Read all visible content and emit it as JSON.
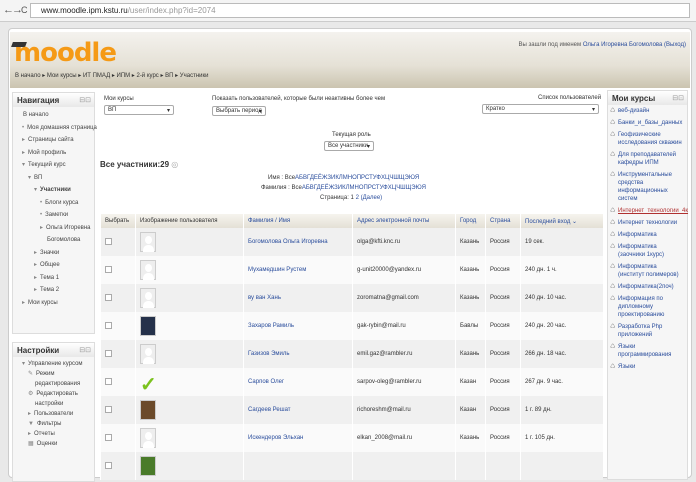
{
  "browser": {
    "url_host": "www.moodle.ipm.kstu.ru",
    "url_path": "/user/index.php?id=2074"
  },
  "header": {
    "logo": "moodle",
    "breadcrumb": "В начало ▸ Мои курсы ▸ ИТ ПМАД ▸ ИПМ ▸ 2-й курс ▸ ВП ▸ Участники",
    "login_prefix": "Вы зашли под именем",
    "login_user": "Ольга Игоревна Богомолова",
    "logout": "(Выход)"
  },
  "navigation": {
    "title": "Навигация",
    "items": [
      {
        "label": "В начало",
        "indent": 0,
        "marker": ""
      },
      {
        "label": "Моя домашняя страница",
        "indent": 1,
        "marker": "•"
      },
      {
        "label": "Страницы сайта",
        "indent": 1,
        "marker": "▸"
      },
      {
        "label": "Мой профиль",
        "indent": 1,
        "marker": "▸"
      },
      {
        "label": "Текущий курс",
        "indent": 1,
        "marker": "▾"
      },
      {
        "label": "ВП",
        "indent": 2,
        "marker": "▾"
      },
      {
        "label": "Участники",
        "indent": 3,
        "marker": "▾"
      },
      {
        "label": "Блоги курса",
        "indent": 4,
        "marker": "•"
      },
      {
        "label": "Заметки",
        "indent": 4,
        "marker": "•"
      },
      {
        "label": "Ольга Игоревна",
        "indent": 4,
        "marker": "▸"
      },
      {
        "label": "Богомолова",
        "indent": 4,
        "marker": ""
      },
      {
        "label": "Значки",
        "indent": 3,
        "marker": "▸"
      },
      {
        "label": "Общее",
        "indent": 3,
        "marker": "▸"
      },
      {
        "label": "Тема 1",
        "indent": 3,
        "marker": "▸"
      },
      {
        "label": "Тема 2",
        "indent": 3,
        "marker": "▸"
      },
      {
        "label": "Мои курсы",
        "indent": 1,
        "marker": "▸"
      }
    ]
  },
  "settings": {
    "title": "Настройки",
    "items": [
      {
        "label": "Управление курсом",
        "indent": 1,
        "marker": "▾"
      },
      {
        "label": "Режим",
        "indent": 2,
        "marker": "✎"
      },
      {
        "label": "редактирования",
        "indent": 2,
        "marker": ""
      },
      {
        "label": "Редактировать",
        "indent": 2,
        "marker": "⚙"
      },
      {
        "label": "настройки",
        "indent": 2,
        "marker": ""
      },
      {
        "label": "Пользователи",
        "indent": 2,
        "marker": "▸"
      },
      {
        "label": "Фильтры",
        "indent": 2,
        "marker": "▼"
      },
      {
        "label": "Отчеты",
        "indent": 2,
        "marker": "▸"
      },
      {
        "label": "Оценки",
        "indent": 2,
        "marker": "▦"
      }
    ]
  },
  "filters": {
    "my_courses_label": "Мои курсы",
    "my_courses_value": "ВП",
    "inactive_label": "Показать пользователей, которые были неактивны более чем",
    "inactive_value": "Выбрать период",
    "list_label": "Список пользователей",
    "list_value": "Кратко",
    "role_label": "Текущая роль",
    "role_value": "Все участники"
  },
  "participants": {
    "title": "Все участники:29",
    "firstname_label": "Имя :",
    "surname_label": "Фамилия :",
    "all": "Все",
    "alphabet": "АБВГДЕЁЖЗИКЛМНОПРСТУФХЦЧШЩЭЮЯ",
    "page_label": "Страница:",
    "pages": [
      "1",
      "2"
    ],
    "next": "(Далее)"
  },
  "table": {
    "headers": [
      "Выбрать",
      "Изображение пользователя",
      "Фамилия / Имя",
      "Адрес электронной почты",
      "Город",
      "Страна",
      "Последний вход"
    ],
    "rows": [
      {
        "avatar": "default",
        "name": "Богомолова Ольга Игоревна",
        "email": "olga@kfti.knc.ru",
        "city": "Казань",
        "country": "Россия",
        "last": "19 сек."
      },
      {
        "avatar": "default",
        "name": "Мухамедшин Рустем",
        "email": "g-unit20000@yandex.ru",
        "city": "Казань",
        "country": "Россия",
        "last": "240 дн. 1 ч."
      },
      {
        "avatar": "default",
        "name": "ву ван Хань",
        "email": "zoromatna@gmail.com",
        "city": "Казань",
        "country": "Россия",
        "last": "240 дн. 10 час."
      },
      {
        "avatar": "dark",
        "name": "Захаров Рамиль",
        "email": "gak-rybin@mail.ru",
        "city": "Бавлы",
        "country": "Россия",
        "last": "240 дн. 20 час."
      },
      {
        "avatar": "default",
        "name": "Газизов Эмиль",
        "email": "emil.gaz@rambler.ru",
        "city": "Казань",
        "country": "Россия",
        "last": "266 дн. 18 час."
      },
      {
        "avatar": "check",
        "name": "Сарпов Олег",
        "email": "sarpov-oleg@rambler.ru",
        "city": "Казан",
        "country": "Россия",
        "last": "267 дн. 9 час."
      },
      {
        "avatar": "brown",
        "name": "Сагдеев Решат",
        "email": "richoreshm@mail.ru",
        "city": "Казан",
        "country": "Россия",
        "last": "1 г. 89 дн."
      },
      {
        "avatar": "default",
        "name": "Искендеров Эльхан",
        "email": "elkan_2008@mail.ru",
        "city": "Казань",
        "country": "Россия",
        "last": "1 г. 105 дн."
      },
      {
        "avatar": "green",
        "name": "",
        "email": "",
        "city": "",
        "country": "",
        "last": ""
      }
    ]
  },
  "my_courses": {
    "title": "Мои курсы",
    "items": [
      "веб-дизайн",
      "Банки_и_базы_данных",
      "Геофизические исследования скважин",
      "Для преподавателей кафедры ИПМ",
      "Инструментальные средства информационных систем",
      "Интернет_технологии_4к",
      "Интернет технологии",
      "Информатика",
      "Информатика (заочники 1курс)",
      "Информатика (институт полимеров)",
      "Информатика(2поч)",
      "Информация по дипломному проектированию",
      "Разработка Php приложений",
      "Языки программирования",
      "Языки"
    ]
  }
}
